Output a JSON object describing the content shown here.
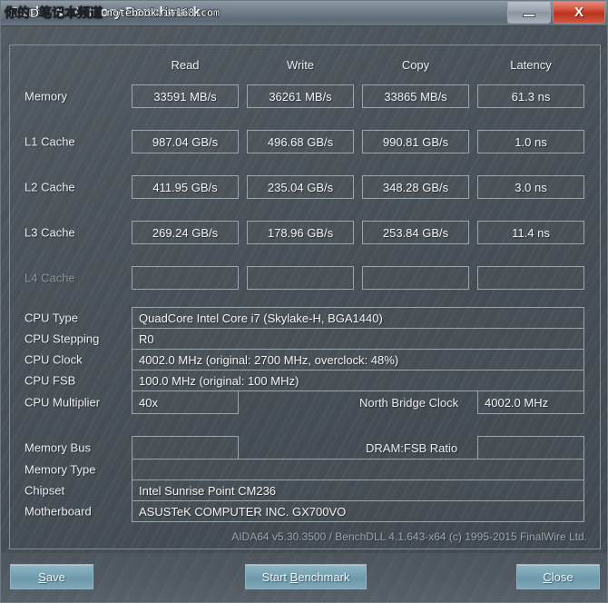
{
  "window": {
    "title": "Cache & Memory Benchmark",
    "watermark_cn": "你的D笔记本频道",
    "watermark_en": "notebook.it168.com",
    "minimize_label": "Minimize",
    "close_label": "X",
    "accent_button_color": "#7ba6b6",
    "close_button_color": "#d4503c",
    "panel_background_color": "#4a5258"
  },
  "benchmark": {
    "columns": [
      "Read",
      "Write",
      "Copy",
      "Latency"
    ],
    "rows": [
      {
        "label": "Memory",
        "dim": false,
        "values": [
          "33591 MB/s",
          "36261 MB/s",
          "33865 MB/s",
          "61.3 ns"
        ]
      },
      {
        "label": "L1 Cache",
        "dim": false,
        "values": [
          "987.04 GB/s",
          "496.68 GB/s",
          "990.81 GB/s",
          "1.0 ns"
        ]
      },
      {
        "label": "L2 Cache",
        "dim": false,
        "values": [
          "411.95 GB/s",
          "235.04 GB/s",
          "348.28 GB/s",
          "3.0 ns"
        ]
      },
      {
        "label": "L3 Cache",
        "dim": false,
        "values": [
          "269.24 GB/s",
          "178.96 GB/s",
          "253.84 GB/s",
          "11.4 ns"
        ]
      },
      {
        "label": "L4 Cache",
        "dim": true,
        "values": [
          "",
          "",
          "",
          ""
        ]
      }
    ]
  },
  "cpu_info": {
    "type_label": "CPU Type",
    "type_value": "QuadCore Intel Core i7  (Skylake-H, BGA1440)",
    "stepping_label": "CPU Stepping",
    "stepping_value": "R0",
    "clock_label": "CPU Clock",
    "clock_value": "4002.0 MHz  (original: 2700 MHz, overclock: 48%)",
    "fsb_label": "CPU FSB",
    "fsb_value": "100.0 MHz  (original: 100 MHz)",
    "multiplier_label": "CPU Multiplier",
    "multiplier_value": "40x",
    "north_bridge_label": "North Bridge Clock",
    "north_bridge_value": "4002.0 MHz"
  },
  "memory_info": {
    "bus_label": "Memory Bus",
    "bus_value": "",
    "dram_fsb_label": "DRAM:FSB Ratio",
    "dram_fsb_value": "",
    "type_label": "Memory Type",
    "type_value": "",
    "chipset_label": "Chipset",
    "chipset_value": "Intel Sunrise Point CM236",
    "motherboard_label": "Motherboard",
    "motherboard_value": "ASUSTeK COMPUTER INC. GX700VO"
  },
  "footer": {
    "version_text": "AIDA64 v5.30.3500 / BenchDLL 4.1.643-x64  (c) 1995-2015 FinalWire Ltd."
  },
  "actions": {
    "save": {
      "pre": "",
      "accel": "S",
      "post": "ave"
    },
    "start": {
      "pre": "Start ",
      "accel": "B",
      "post": "enchmark"
    },
    "close": {
      "pre": "",
      "accel": "C",
      "post": "lose"
    }
  }
}
